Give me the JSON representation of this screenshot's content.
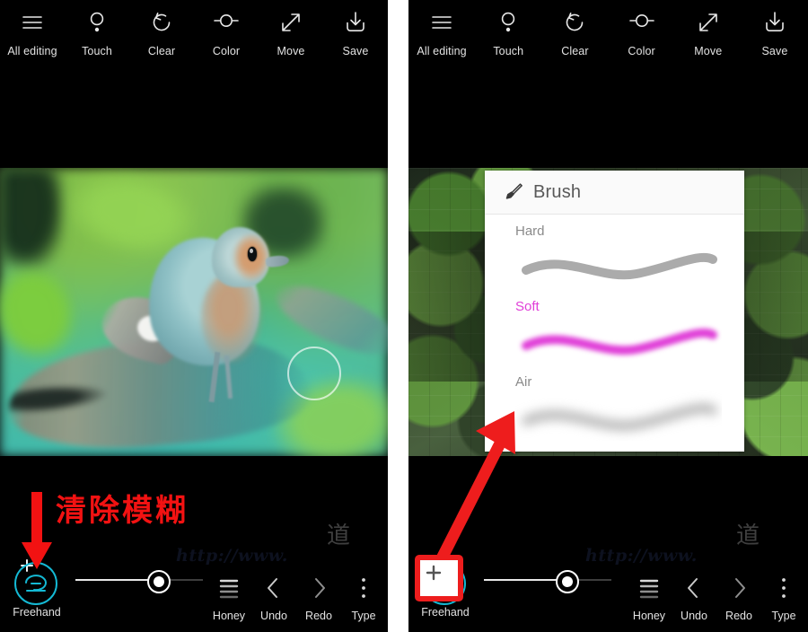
{
  "app": {
    "gap_color": "#ffffff",
    "panel_bg": "#000000",
    "accent_cyan": "#14b9d4",
    "annotation_red": "#ee1d1d",
    "selected_brush_color": "#e040d8"
  },
  "top_toolbar": {
    "items": [
      {
        "label": "All editing",
        "icon": "hamburger-menu-icon"
      },
      {
        "label": "Touch",
        "icon": "touch-pointer-icon"
      },
      {
        "label": "Clear",
        "icon": "undo-circular-arrow-icon"
      },
      {
        "label": "Color",
        "icon": "color-knob-icon"
      },
      {
        "label": "Move",
        "icon": "diagonal-resize-arrow-icon"
      },
      {
        "label": "Save",
        "icon": "download-save-icon"
      }
    ]
  },
  "bottom_toolbar": {
    "tool": {
      "label": "Freehand",
      "icon": "freehand-lasso-icon",
      "add_icon": "plus-icon"
    },
    "slider": {
      "value_percent": 63
    },
    "right_items": [
      {
        "label": "Honey",
        "icon": "stacked-lines-icon"
      },
      {
        "label": "Undo",
        "icon": "chevron-left-icon"
      },
      {
        "label": "Redo",
        "icon": "chevron-right-icon"
      },
      {
        "label": "Type",
        "icon": "vertical-dots-icon"
      }
    ]
  },
  "brush_popup": {
    "title": "Brush",
    "icon": "paintbrush-icon",
    "options": [
      {
        "label": "Hard",
        "selected": false,
        "stroke_color": "#ababab",
        "blur": 0
      },
      {
        "label": "Soft",
        "selected": true,
        "stroke_color": "#e040d8",
        "blur": 3
      },
      {
        "label": "Air",
        "selected": false,
        "stroke_color": "#b0b0b0",
        "blur": 6
      }
    ]
  },
  "annotations": {
    "chinese_caption": "清除模糊",
    "down_arrow": "red-down-arrow",
    "diagonal_arrow": "red-diagonal-arrow",
    "highlight_box": "red-highlight-box"
  },
  "watermark": {
    "url": "http://www.",
    "seal": "道"
  },
  "canvas": {
    "left": {
      "subject": "bird-on-branch-photo",
      "effect": "blur-with-clear-brush"
    },
    "right": {
      "subject": "bird-on-branch-photo",
      "effect": "hexagon-mosaic-pixelate"
    }
  }
}
